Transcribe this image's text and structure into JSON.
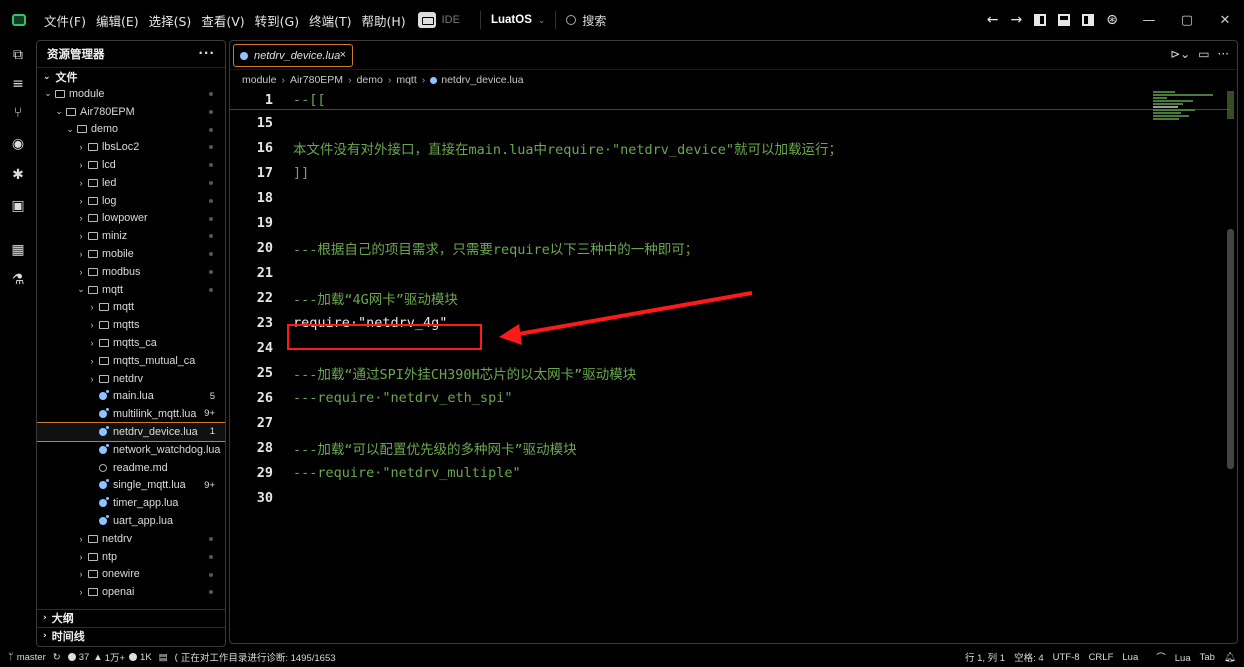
{
  "menu": [
    "文件(F)",
    "编辑(E)",
    "选择(S)",
    "查看(V)",
    "转到(G)",
    "终端(T)",
    "帮助(H)"
  ],
  "ide_label": "IDE",
  "env_select": "LuatOS",
  "search_label": "搜索",
  "title_icons": {
    "back": "←",
    "forward": "→",
    "account": "⊛",
    "minimize": "—",
    "restore": "▢",
    "close": "✕"
  },
  "sidebar": {
    "title": "资源管理器",
    "more": "···",
    "section": "文件",
    "tree": [
      {
        "label": "module",
        "level": 0,
        "type": "folder",
        "open": true,
        "dot": true
      },
      {
        "label": "Air780EPM",
        "level": 1,
        "type": "folder",
        "open": true,
        "dot": true
      },
      {
        "label": "demo",
        "level": 2,
        "type": "folder",
        "open": true,
        "dot": true
      },
      {
        "label": "lbsLoc2",
        "level": 3,
        "type": "folder",
        "open": false,
        "dot": true
      },
      {
        "label": "lcd",
        "level": 3,
        "type": "folder",
        "open": false,
        "dot": true
      },
      {
        "label": "led",
        "level": 3,
        "type": "folder",
        "open": false,
        "dot": true
      },
      {
        "label": "log",
        "level": 3,
        "type": "folder",
        "open": false,
        "dot": true
      },
      {
        "label": "lowpower",
        "level": 3,
        "type": "folder",
        "open": false,
        "dot": true
      },
      {
        "label": "miniz",
        "level": 3,
        "type": "folder",
        "open": false,
        "dot": true
      },
      {
        "label": "mobile",
        "level": 3,
        "type": "folder",
        "open": false,
        "dot": true
      },
      {
        "label": "modbus",
        "level": 3,
        "type": "folder",
        "open": false,
        "dot": true
      },
      {
        "label": "mqtt",
        "level": 3,
        "type": "folder",
        "open": true,
        "dot": true
      },
      {
        "label": "mqtt",
        "level": 4,
        "type": "folder",
        "open": false
      },
      {
        "label": "mqtts",
        "level": 4,
        "type": "folder",
        "open": false
      },
      {
        "label": "mqtts_ca",
        "level": 4,
        "type": "folder",
        "open": false
      },
      {
        "label": "mqtts_mutual_ca",
        "level": 4,
        "type": "folder",
        "open": false
      },
      {
        "label": "netdrv",
        "level": 4,
        "type": "folder",
        "open": false
      },
      {
        "label": "main.lua",
        "level": 4,
        "type": "lua",
        "count": "5"
      },
      {
        "label": "multilink_mqtt.lua",
        "level": 4,
        "type": "lua",
        "count": "9+"
      },
      {
        "label": "netdrv_device.lua",
        "level": 4,
        "type": "lua",
        "count": "1",
        "selected": true
      },
      {
        "label": "network_watchdog.lua",
        "level": 4,
        "type": "lua"
      },
      {
        "label": "readme.md",
        "level": 4,
        "type": "info"
      },
      {
        "label": "single_mqtt.lua",
        "level": 4,
        "type": "lua",
        "count": "9+"
      },
      {
        "label": "timer_app.lua",
        "level": 4,
        "type": "lua"
      },
      {
        "label": "uart_app.lua",
        "level": 4,
        "type": "lua"
      },
      {
        "label": "netdrv",
        "level": 3,
        "type": "folder",
        "open": false,
        "dot": true
      },
      {
        "label": "ntp",
        "level": 3,
        "type": "folder",
        "open": false,
        "dot": true
      },
      {
        "label": "onewire",
        "level": 3,
        "type": "folder",
        "open": false,
        "dot": true
      },
      {
        "label": "openai",
        "level": 3,
        "type": "folder",
        "open": false,
        "dot": true
      }
    ],
    "outline": "大纲",
    "timeline": "时间线"
  },
  "editor": {
    "tab_label": "netdrv_device.lua",
    "tab_close": "×",
    "breadcrumb": [
      "module",
      "Air780EPM",
      "demo",
      "mqtt",
      "netdrv_device.lua"
    ],
    "lines": [
      {
        "no": "1",
        "text": "--[[",
        "kind": "comment"
      },
      {
        "no": "15",
        "text": "",
        "kind": "comment"
      },
      {
        "no": "16",
        "text": "本文件没有对外接口，直接在main.lua中require·\"netdrv_device\"就可以加载运行；",
        "kind": "comment"
      },
      {
        "no": "17",
        "text": "]]",
        "kind": "comment"
      },
      {
        "no": "18",
        "text": "",
        "kind": "comment"
      },
      {
        "no": "19",
        "text": "",
        "kind": "comment"
      },
      {
        "no": "20",
        "text": "---根据自己的项目需求，只需要require以下三种中的一种即可；",
        "kind": "comment"
      },
      {
        "no": "21",
        "text": "",
        "kind": "comment"
      },
      {
        "no": "22",
        "text": "---加载“4G网卡”驱动模块",
        "kind": "comment"
      },
      {
        "no": "23",
        "text": "require·\"netdrv_4g\"",
        "kind": "plain"
      },
      {
        "no": "24",
        "text": "",
        "kind": "comment"
      },
      {
        "no": "25",
        "text": "---加载“通过SPI外挂CH390H芯片的以太网卡”驱动模块",
        "kind": "comment"
      },
      {
        "no": "26",
        "text": "---require·\"netdrv_eth_spi\"",
        "kind": "comment"
      },
      {
        "no": "27",
        "text": "",
        "kind": "comment"
      },
      {
        "no": "28",
        "text": "---加载“可以配置优先级的多种网卡”驱动模块",
        "kind": "comment"
      },
      {
        "no": "29",
        "text": "---require·\"netdrv_multiple\"",
        "kind": "comment"
      },
      {
        "no": "30",
        "text": "",
        "kind": "comment"
      }
    ]
  },
  "status": {
    "branch": "master",
    "errors": "37",
    "warnings": "1万+",
    "infos": "1K",
    "task": "正在对工作目录进行诊断: 1495/1653",
    "position": "行 1, 列 1",
    "spaces": "空格: 4",
    "encoding": "UTF-8",
    "eol": "CRLF",
    "language": "Lua",
    "lua_server": "Lua",
    "tab": "Tab"
  },
  "colors": {
    "accent": "#d07a2c",
    "annotation": "#ff1a1a",
    "comment": "#6aa84f"
  }
}
